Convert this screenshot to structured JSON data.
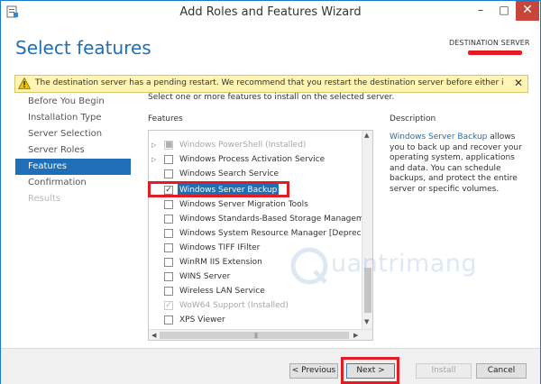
{
  "window": {
    "title": "Add Roles and Features Wizard",
    "minimize_glyph": "–",
    "maximize_glyph": "□",
    "close_glyph": "✕"
  },
  "header": {
    "page_title": "Select features",
    "destination_label": "DESTINATION SERVER"
  },
  "warning": {
    "text": "The destination server has a pending restart. We recommend that you restart the destination server before either installing o...",
    "close_glyph": "✕"
  },
  "nav": {
    "items": [
      {
        "label": "Before You Begin"
      },
      {
        "label": "Installation Type"
      },
      {
        "label": "Server Selection"
      },
      {
        "label": "Server Roles"
      },
      {
        "label": "Features"
      },
      {
        "label": "Confirmation"
      },
      {
        "label": "Results"
      }
    ]
  },
  "main": {
    "instruction": "Select one or more features to install on the selected server.",
    "features_heading": "Features",
    "features": [
      {
        "label": "Windows PowerShell (Installed)",
        "state": "installed"
      },
      {
        "label": "Windows Process Activation Service",
        "state": "unchecked"
      },
      {
        "label": "Windows Search Service",
        "state": "unchecked"
      },
      {
        "label": "Windows Server Backup",
        "state": "checked"
      },
      {
        "label": "Windows Server Migration Tools",
        "state": "unchecked"
      },
      {
        "label": "Windows Standards-Based Storage Management",
        "state": "unchecked"
      },
      {
        "label": "Windows System Resource Manager [Deprecated]",
        "state": "unchecked"
      },
      {
        "label": "Windows TIFF IFilter",
        "state": "unchecked"
      },
      {
        "label": "WinRM IIS Extension",
        "state": "unchecked"
      },
      {
        "label": "WINS Server",
        "state": "unchecked"
      },
      {
        "label": "Wireless LAN Service",
        "state": "unchecked"
      },
      {
        "label": "WoW64 Support (Installed)",
        "state": "installed"
      },
      {
        "label": "XPS Viewer",
        "state": "unchecked"
      }
    ]
  },
  "description": {
    "heading": "Description",
    "link_text": "Windows Server Backup",
    "body": " allows you to back up and recover your operating system, applications and data. You can schedule backups, and protect the entire server or specific volumes."
  },
  "watermark": {
    "text": "uantrimang"
  },
  "footer": {
    "previous_label": "< Previous",
    "next_label": "Next >",
    "install_label": "Install",
    "cancel_label": "Cancel"
  },
  "colors": {
    "accent": "#1e6fb8",
    "annotation_red": "#e31c23",
    "warning_bg": "#fff4b3",
    "close_red": "#c7463b"
  }
}
